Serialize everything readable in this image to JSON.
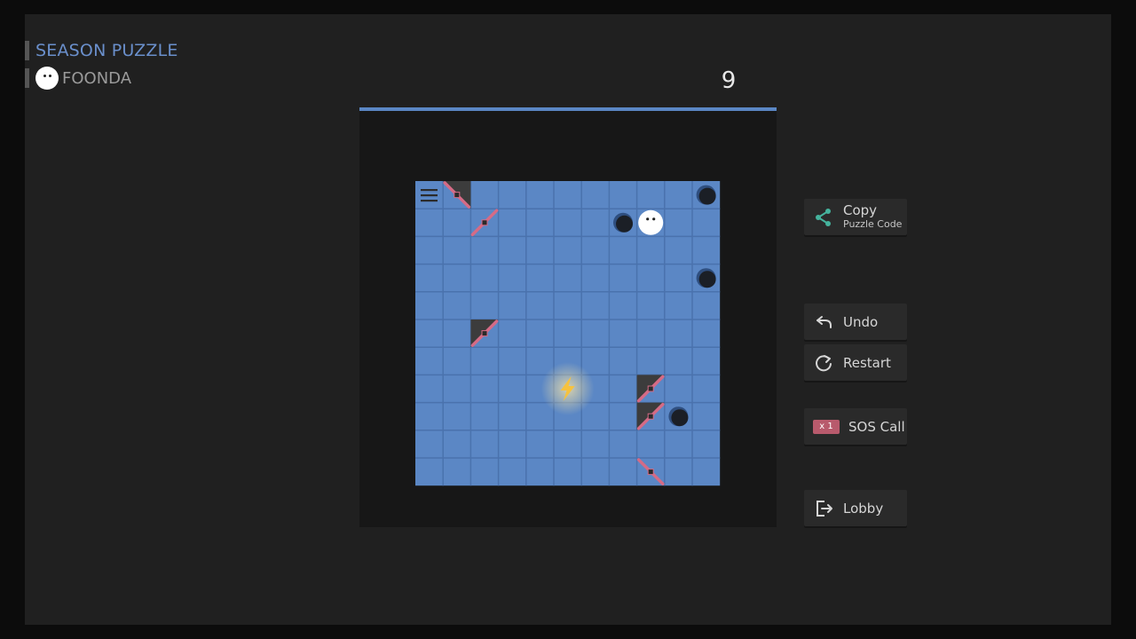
{
  "header": {
    "title": "SEASON PUZZLE",
    "player_name": "FOONDA"
  },
  "moves_left": "9",
  "board": {
    "cols": 11,
    "rows": 11,
    "colors": {
      "tile": "#5b87c5",
      "grid_line": "#4a72ad",
      "hole": "#1b1f26",
      "blade": "#d56b86",
      "block": "#3c3c3c",
      "ball": "#ffffff",
      "lightning": "#f6c23e"
    },
    "menu_icon": "hamburger-menu-icon",
    "ball": {
      "col": 8,
      "row": 1
    },
    "holes": [
      {
        "col": 10,
        "row": 0
      },
      {
        "col": 7,
        "row": 1
      },
      {
        "col": 10,
        "row": 3
      },
      {
        "col": 9,
        "row": 8
      }
    ],
    "blades": [
      {
        "col": 1,
        "row": 0,
        "dir": "backslash",
        "block": true
      },
      {
        "col": 2,
        "row": 1,
        "dir": "slash",
        "block": false
      },
      {
        "col": 2,
        "row": 5,
        "dir": "slash",
        "block": true
      },
      {
        "col": 8,
        "row": 7,
        "dir": "slash",
        "block": true
      },
      {
        "col": 8,
        "row": 8,
        "dir": "slash",
        "block": true
      },
      {
        "col": 8,
        "row": 10,
        "dir": "backslash",
        "block": false
      }
    ],
    "lightning": {
      "col": 5,
      "row": 7
    }
  },
  "buttons": {
    "copy": {
      "label": "Copy",
      "sub": "Puzzle Code",
      "icon": "share-icon"
    },
    "undo": {
      "label": "Undo",
      "icon": "undo-icon"
    },
    "restart": {
      "label": "Restart",
      "icon": "restart-icon"
    },
    "sos": {
      "label": "SOS Call",
      "ticket": "x 1",
      "icon": "sos-ticket-icon"
    },
    "lobby": {
      "label": "Lobby",
      "icon": "exit-icon"
    }
  }
}
